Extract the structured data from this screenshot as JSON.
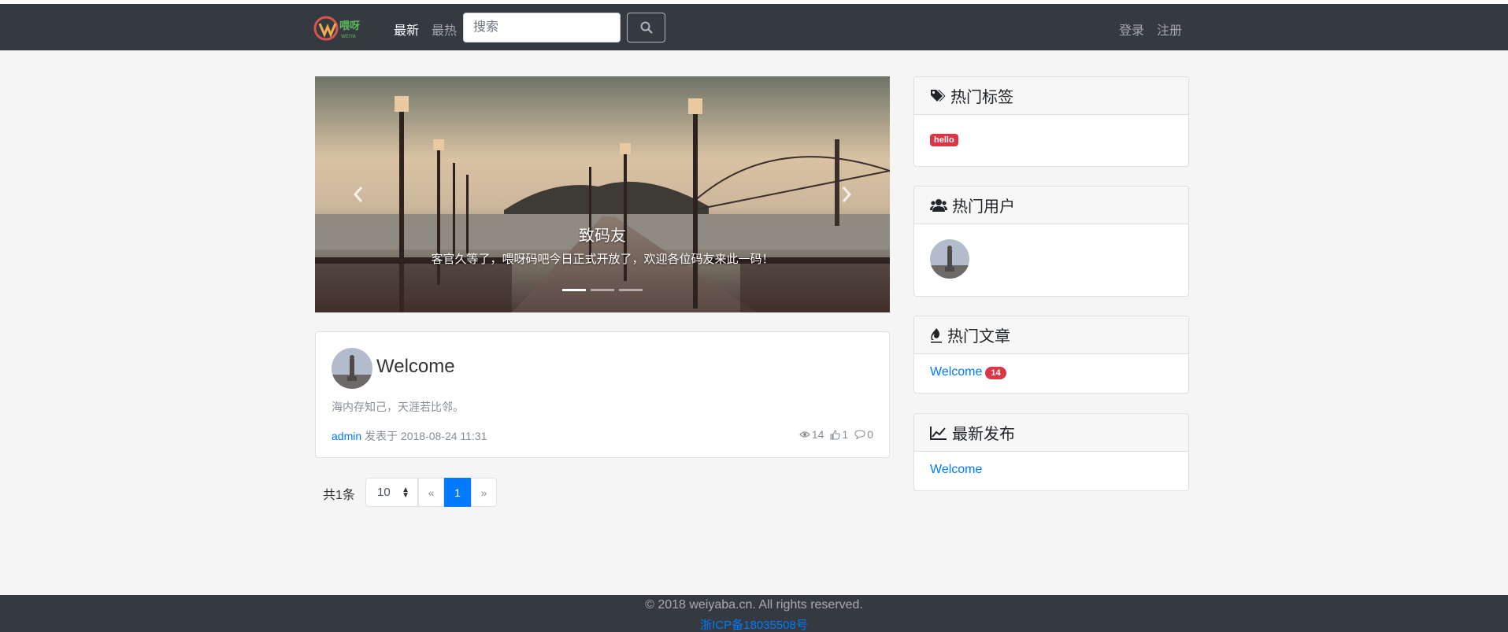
{
  "navbar": {
    "logo_text": "喂呀",
    "logo_sub": "WEIYA",
    "links": [
      {
        "label": "最新",
        "active": true
      },
      {
        "label": "最热",
        "active": false
      }
    ],
    "search_placeholder": "搜索",
    "login_label": "登录",
    "register_label": "注册"
  },
  "carousel": {
    "title": "致码友",
    "text": "客官久等了，喂呀码吧今日正式开放了，欢迎各位码友来此一码！",
    "slide_count": 3,
    "active_index": 0
  },
  "post": {
    "title": "Welcome",
    "summary": "海内存知己，天涯若比邻。",
    "author": "admin",
    "published_label": "发表于",
    "date": "2018-08-24 11:31",
    "views": "14",
    "likes": "1",
    "comments": "0"
  },
  "pagination": {
    "total_label": "共1条",
    "page_size": "10",
    "prev": "«",
    "current": "1",
    "next": "»"
  },
  "sidebar": {
    "hot_tags": {
      "title": "热门标签",
      "tags": [
        "hello"
      ]
    },
    "hot_users": {
      "title": "热门用户"
    },
    "hot_articles": {
      "title": "热门文章",
      "items": [
        {
          "label": "Welcome",
          "count": "14"
        }
      ]
    },
    "latest": {
      "title": "最新发布",
      "items": [
        {
          "label": "Welcome"
        }
      ]
    }
  },
  "footer": {
    "copyright": "© 2018 weiyaba.cn. All rights reserved.",
    "icp": "浙ICP备18035508号"
  },
  "colors": {
    "navbar": "#343a40",
    "primary": "#007bff",
    "danger": "#dc3545",
    "background": "#f5f5f5"
  }
}
